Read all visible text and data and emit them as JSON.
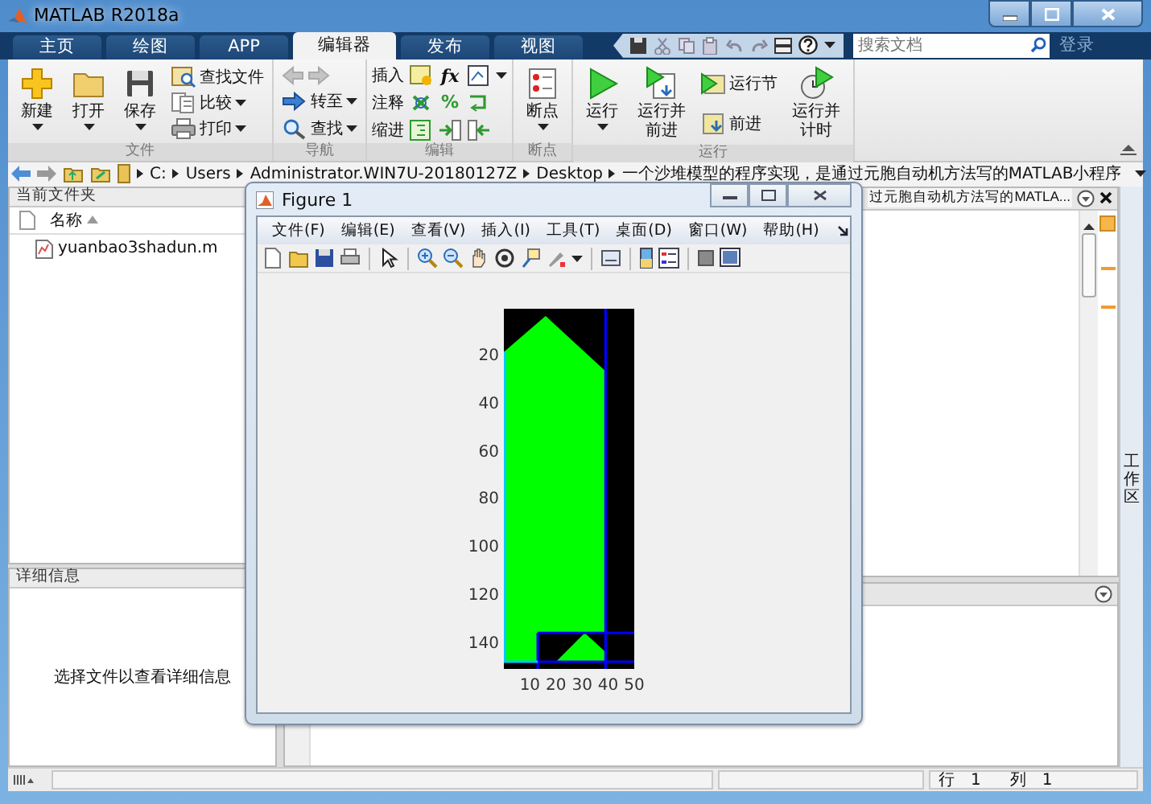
{
  "window": {
    "title": "MATLAB R2018a"
  },
  "tabs": [
    {
      "label": "主页",
      "selected": false
    },
    {
      "label": "绘图",
      "selected": false
    },
    {
      "label": "APP",
      "selected": false
    },
    {
      "label": "编辑器",
      "selected": true
    },
    {
      "label": "发布",
      "selected": false
    },
    {
      "label": "视图",
      "selected": false
    }
  ],
  "search": {
    "placeholder": "搜索文档"
  },
  "sign_in": "登录",
  "ribbon": {
    "groups": [
      {
        "label": "文件",
        "buttons": [
          {
            "label": "新建",
            "kind": "large",
            "dropdown": true
          },
          {
            "label": "打开",
            "kind": "large",
            "dropdown": true
          },
          {
            "label": "保存",
            "kind": "large",
            "dropdown": true
          },
          {
            "label": "查找文件",
            "kind": "small",
            "dropdown": false
          },
          {
            "label": "比较",
            "kind": "small",
            "dropdown": true
          },
          {
            "label": "打印",
            "kind": "small",
            "dropdown": true
          }
        ]
      },
      {
        "label": "导航",
        "buttons": [
          {
            "kind": "arrows",
            "disabled": true
          },
          {
            "label": "转至",
            "kind": "small",
            "dropdown": true
          },
          {
            "label": "查找",
            "kind": "small",
            "dropdown": true
          }
        ]
      },
      {
        "label": "编辑",
        "buttons": [
          {
            "label": "插入",
            "kind": "row",
            "glyph": "fx",
            "dropdown": true
          },
          {
            "label": "注释",
            "kind": "row",
            "glyph": "%",
            "dropdown": false
          },
          {
            "label": "缩进",
            "kind": "row",
            "dropdown": false
          }
        ]
      },
      {
        "label": "断点",
        "buttons": [
          {
            "label": "断点",
            "kind": "large",
            "dropdown": true
          }
        ]
      },
      {
        "label": "运行",
        "buttons": [
          {
            "label": "运行",
            "kind": "large",
            "dropdown": true
          },
          {
            "label": "运行并前进",
            "kind": "large",
            "dropdown": false
          },
          {
            "label": "运行节",
            "kind": "small",
            "dropdown": false
          },
          {
            "label": "前进",
            "kind": "small",
            "dropdown": false
          },
          {
            "label": "运行并计时",
            "kind": "large",
            "dropdown": false
          }
        ]
      }
    ]
  },
  "address": {
    "path": [
      "C:",
      "Users",
      "Administrator.WIN7U-20180127Z",
      "Desktop",
      "一个沙堆模型的程序实现，是通过元胞自动机方法写的MATLAB小程序"
    ]
  },
  "current_folder": {
    "title": "当前文件夹",
    "column": "名称",
    "files": [
      "yuanbao3shadun.m"
    ]
  },
  "details": {
    "title": "详细信息",
    "message": "选择文件以查看详细信息"
  },
  "editor": {
    "tab_label": "过元胞自动机方法写的MATLA..."
  },
  "workspace_tab": "工作区",
  "status_bar": {
    "row_label": "行",
    "row": "1",
    "column_label": "列",
    "column": "1"
  },
  "figure": {
    "title": "Figure 1",
    "menu": [
      "文件(F)",
      "编辑(E)",
      "查看(V)",
      "插入(I)",
      "工具(T)",
      "桌面(D)",
      "窗口(W)",
      "帮助(H)"
    ],
    "axes": {
      "yticks": [
        "20",
        "40",
        "60",
        "80",
        "100",
        "120",
        "140"
      ],
      "xticks": [
        "10",
        "20",
        "30",
        "40",
        "50"
      ]
    }
  }
}
